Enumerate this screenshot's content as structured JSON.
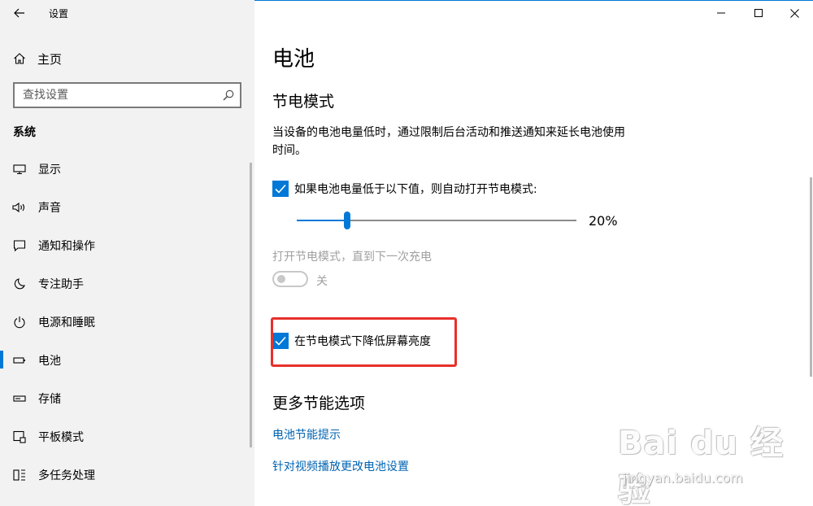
{
  "window": {
    "app_title": "设置",
    "accent_color": "#0078d7"
  },
  "sidebar": {
    "home_label": "主页",
    "search_placeholder": "查找设置",
    "section_title": "系统",
    "items": [
      {
        "label": "显示",
        "icon": "monitor-icon",
        "active": false
      },
      {
        "label": "声音",
        "icon": "speaker-icon",
        "active": false
      },
      {
        "label": "通知和操作",
        "icon": "notification-icon",
        "active": false
      },
      {
        "label": "专注助手",
        "icon": "moon-icon",
        "active": false
      },
      {
        "label": "电源和睡眠",
        "icon": "power-icon",
        "active": false
      },
      {
        "label": "电池",
        "icon": "battery-icon",
        "active": true
      },
      {
        "label": "存储",
        "icon": "storage-icon",
        "active": false
      },
      {
        "label": "平板模式",
        "icon": "tablet-icon",
        "active": false
      },
      {
        "label": "多任务处理",
        "icon": "multitask-icon",
        "active": false
      }
    ]
  },
  "main": {
    "page_title": "电池",
    "saver_heading": "节电模式",
    "saver_description": "当设备的电池电量低时，通过限制后台活动和推送通知来延长电池使用时间。",
    "auto_saver_label": "如果电池电量低于以下值，则自动打开节电模式:",
    "auto_saver_checked": true,
    "threshold_percent": 20,
    "threshold_label": "20%",
    "saver_now_label": "打开节电模式，直到下一次充电",
    "saver_toggle_state": "关",
    "saver_toggle_on": false,
    "lower_brightness_label": "在节电模式下降低屏幕亮度",
    "lower_brightness_checked": true,
    "more_heading": "更多节能选项",
    "links": [
      "电池节能提示",
      "针对视频播放更改电池设置"
    ]
  },
  "watermark": {
    "logo": "Bai du 经验",
    "url": "jingyan.baidu.com"
  }
}
